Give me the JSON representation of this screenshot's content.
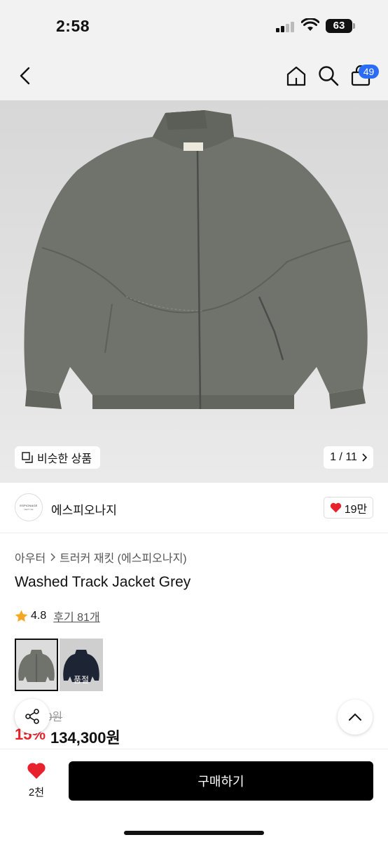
{
  "status": {
    "time": "2:58",
    "battery": "63"
  },
  "nav": {
    "cart_count": "49",
    "icons": [
      "back-arrow-icon",
      "home-icon",
      "search-icon",
      "shopping-bag-icon"
    ]
  },
  "hero": {
    "similar_label": "비슷한 상품",
    "counter": "1 / 11"
  },
  "brand": {
    "logo_text": "ESPIONAGE",
    "logo_subtext": "NEXT NE",
    "name": "에스피오나지",
    "likes": "19만"
  },
  "breadcrumb": {
    "category": "아우터",
    "subcategory": "트러커 재킷 (에스피오나지)"
  },
  "product": {
    "title": "Washed Track Jacket Grey",
    "rating": "4.8",
    "reviews": "후기 81개"
  },
  "variants": [
    {
      "label": "",
      "color": "#6f736c"
    },
    {
      "label": "품절",
      "color": "#1d2433"
    }
  ],
  "price": {
    "original": "0원",
    "discount": "15%",
    "sale": "134,300원"
  },
  "bottom": {
    "wish_count": "2천",
    "buy_label": "구매하기"
  },
  "colors": {
    "accent": "#2b6cf6",
    "discount": "#e8222c",
    "heart": "#e8222c",
    "buy_button": "#000000"
  }
}
